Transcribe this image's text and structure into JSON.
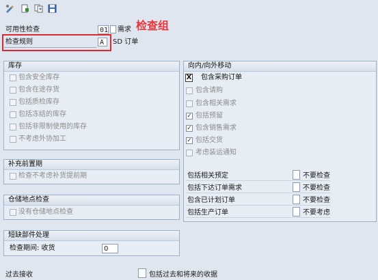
{
  "toolbar": {
    "icons": [
      "display-change-icon",
      "create-icon",
      "copy-icon",
      "save-icon"
    ]
  },
  "fields": {
    "availability_check": {
      "label": "可用性检查",
      "value": "01",
      "desc": "需求"
    },
    "checking_rule": {
      "label": "检查规则",
      "value": "A",
      "desc": "SD 订单"
    }
  },
  "annotation": {
    "text": "检查组",
    "color": "#e8343a"
  },
  "groups": {
    "stock": {
      "title": "库存",
      "items": [
        {
          "label": "包含安全库存",
          "checked": false
        },
        {
          "label": "包含在途存货",
          "checked": false
        },
        {
          "label": "包括质检库存",
          "checked": false
        },
        {
          "label": "包括冻结的库存",
          "checked": false
        },
        {
          "label": "包括非限制使用的库存",
          "checked": false
        },
        {
          "label": "不考虑外协加工",
          "checked": false
        }
      ]
    },
    "replenishment": {
      "title": "补充前置期",
      "items": [
        {
          "label": "检查不考虑补货提前期",
          "checked": false
        }
      ]
    },
    "storage": {
      "title": "仓储地点检查",
      "items": [
        {
          "label": "没有仓储地点检查",
          "checked": false
        }
      ]
    },
    "missing_parts": {
      "title": "短缺部件处理",
      "period_label": "检查期间: 收货",
      "period_value": "0"
    },
    "inout": {
      "title": "向内/向外移动",
      "items": [
        {
          "label": "包含采购订单",
          "checked": true,
          "style": "x"
        },
        {
          "label": "包含请购",
          "checked": false
        },
        {
          "label": "包含相关需求",
          "checked": false
        },
        {
          "label": "包括预留",
          "checked": true
        },
        {
          "label": "包含销售需求",
          "checked": true
        },
        {
          "label": "包括交货",
          "checked": true
        },
        {
          "label": "考虑装运通知",
          "checked": false
        }
      ],
      "rows": [
        {
          "label": "包括相关预定",
          "value": "不要检查"
        },
        {
          "label": "包括下达订单需求",
          "value": "不要检查"
        },
        {
          "label": "包含已计划订单",
          "value": "不要检查"
        },
        {
          "label": "包括生产订单",
          "value": "不要考虑"
        }
      ]
    }
  },
  "bottom": {
    "past_receipts_label": "过去接收",
    "past_future_label": "包括过去和将来的收据"
  }
}
